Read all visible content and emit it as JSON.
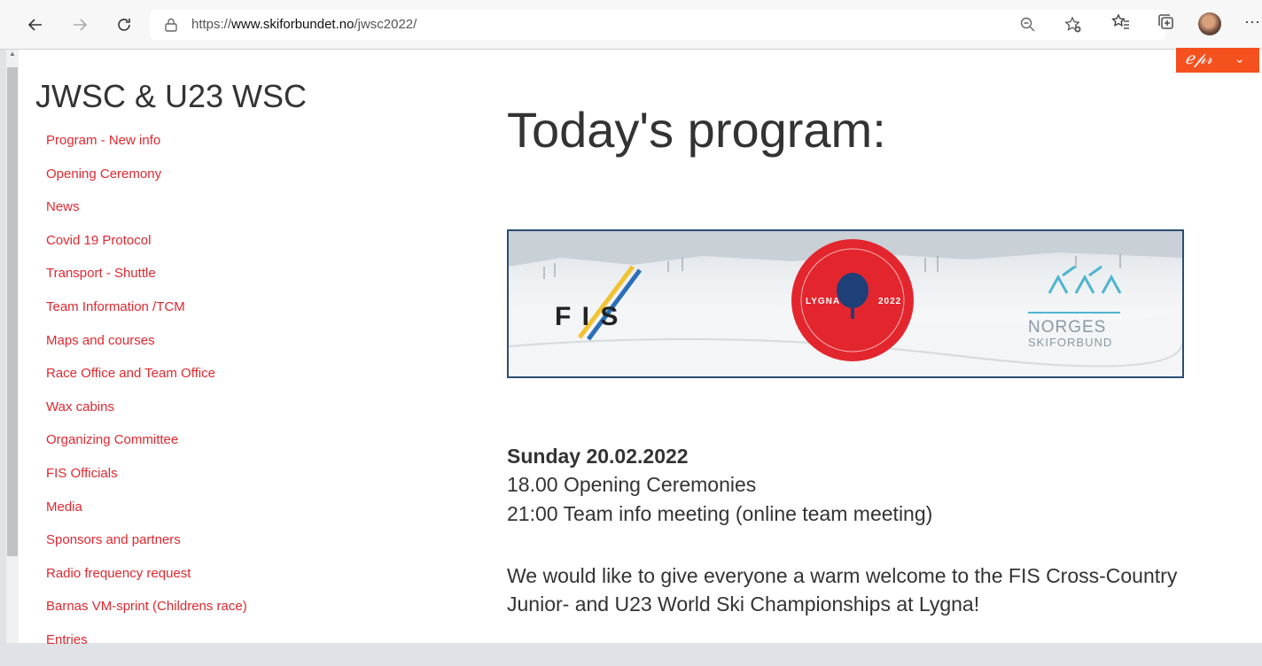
{
  "browser": {
    "url_prefix": "https://",
    "url_domain": "www.skiforbundet.no",
    "url_path": "/jwsc2022/",
    "back_icon": "back-arrow-icon",
    "forward_icon": "forward-arrow-icon",
    "refresh_icon": "refresh-icon"
  },
  "sidebar": {
    "title": "JWSC & U23 WSC",
    "items": [
      {
        "label": "Program - New info"
      },
      {
        "label": "Opening Ceremony"
      },
      {
        "label": "News"
      },
      {
        "label": "Covid 19 Protocol"
      },
      {
        "label": "Transport - Shuttle"
      },
      {
        "label": "Team Information /TCM"
      },
      {
        "label": "Maps and courses"
      },
      {
        "label": "Race Office and Team Office"
      },
      {
        "label": "Wax cabins"
      },
      {
        "label": "Organizing Committee"
      },
      {
        "label": "FIS Officials"
      },
      {
        "label": "Media"
      },
      {
        "label": "Sponsors and partners"
      },
      {
        "label": "Radio frequency request"
      },
      {
        "label": "Barnas VM-sprint (Childrens race)"
      },
      {
        "label": "Entries"
      }
    ]
  },
  "main": {
    "title": "Today's program:",
    "banner": {
      "fis_text": "F I S",
      "emblem_left": "LYGNA",
      "emblem_right": "2022",
      "norges": "NORGES",
      "skiforbund": "SKIFORBUND"
    },
    "schedule": {
      "date": "Sunday 20.02.2022",
      "events": [
        "18.00 Opening Ceremonies",
        "21:00 Team info meeting (online team meeting)"
      ]
    },
    "welcome": "We would like to give everyone a warm welcome to the FIS Cross-Country Junior- and U23 World Ski Championships at Lygna!"
  },
  "colors": {
    "link": "#e0282f",
    "text": "#333333",
    "emblem": "#e3262e",
    "extension": "#f4511e"
  }
}
